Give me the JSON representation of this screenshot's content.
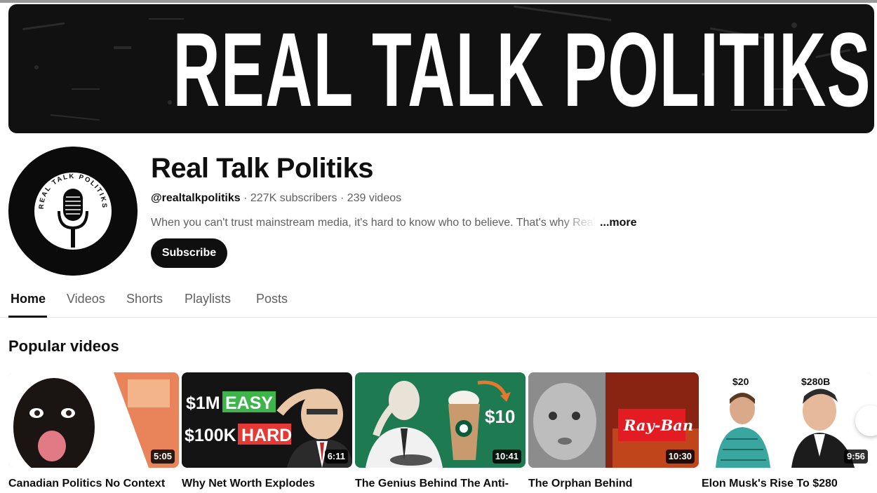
{
  "banner": {
    "text": "REAL TALK POLITIKS"
  },
  "avatar": {
    "ring_text": "REAL TALK POLITIKS"
  },
  "channel": {
    "name": "Real Talk Politiks",
    "handle": "@realtalkpolitiks",
    "subscribers": "227K subscribers",
    "videos": "239 videos",
    "separator": " · ",
    "description": "When you can't trust mainstream media, it's hard to know who to believe. That's why Real",
    "more_label": "...more",
    "subscribe_label": "Subscribe"
  },
  "tabs": [
    {
      "label": "Home",
      "active": true
    },
    {
      "label": "Videos",
      "active": false
    },
    {
      "label": "Shorts",
      "active": false
    },
    {
      "label": "Playlists",
      "active": false
    },
    {
      "label": "Posts",
      "active": false
    }
  ],
  "section": {
    "title": "Popular videos"
  },
  "videos": [
    {
      "title": "Canadian Politics No Context",
      "duration": "5:05"
    },
    {
      "title": "Why Net Worth Explodes",
      "duration": "6:11",
      "thumb_text": [
        "$1M",
        "EASY",
        "$100K",
        "HARD"
      ]
    },
    {
      "title": "The Genius Behind The Anti-",
      "duration": "10:41",
      "thumb_text": [
        "$10"
      ]
    },
    {
      "title": "The Orphan Behind",
      "duration": "10:30",
      "thumb_text": [
        "Ray-Ban"
      ]
    },
    {
      "title": "Elon Musk's Rise To $280",
      "duration": "9:56",
      "thumb_text": [
        "$20",
        "$280B"
      ]
    }
  ],
  "colors": {
    "subscribe_bg": "#0f0f0f",
    "easy_green": "#3db54a",
    "hard_red": "#e53935",
    "starbucks_green": "#1e7a50",
    "rayban_red": "#e31b23"
  }
}
